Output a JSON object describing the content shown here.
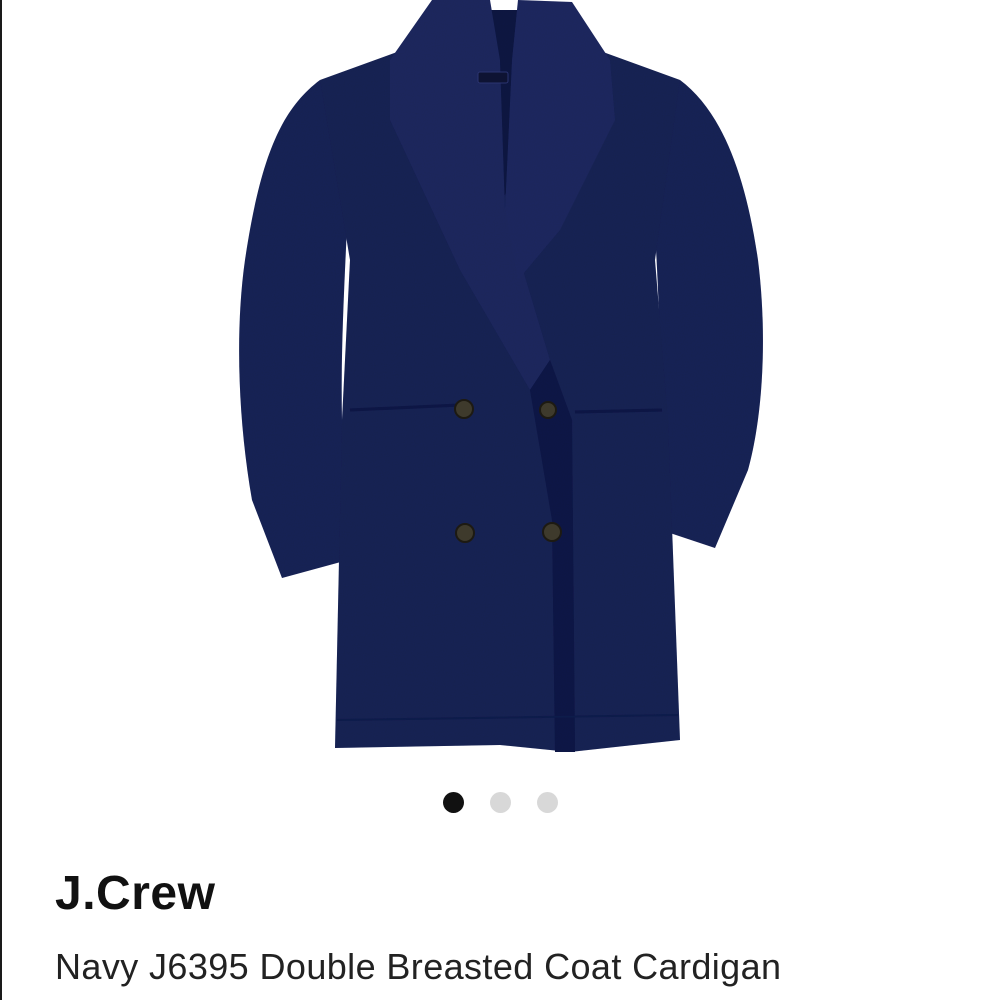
{
  "product": {
    "brand": "J.Crew",
    "title": "Navy J6395 Double Breasted Coat Cardigan",
    "garment_color": "#1c2556"
  },
  "carousel": {
    "total": 3,
    "active_index": 0,
    "active_color": "#111111",
    "inactive_color": "#d8d8d8"
  },
  "icons": {
    "label": "neck-label-icon",
    "button": "coat-button-icon"
  }
}
